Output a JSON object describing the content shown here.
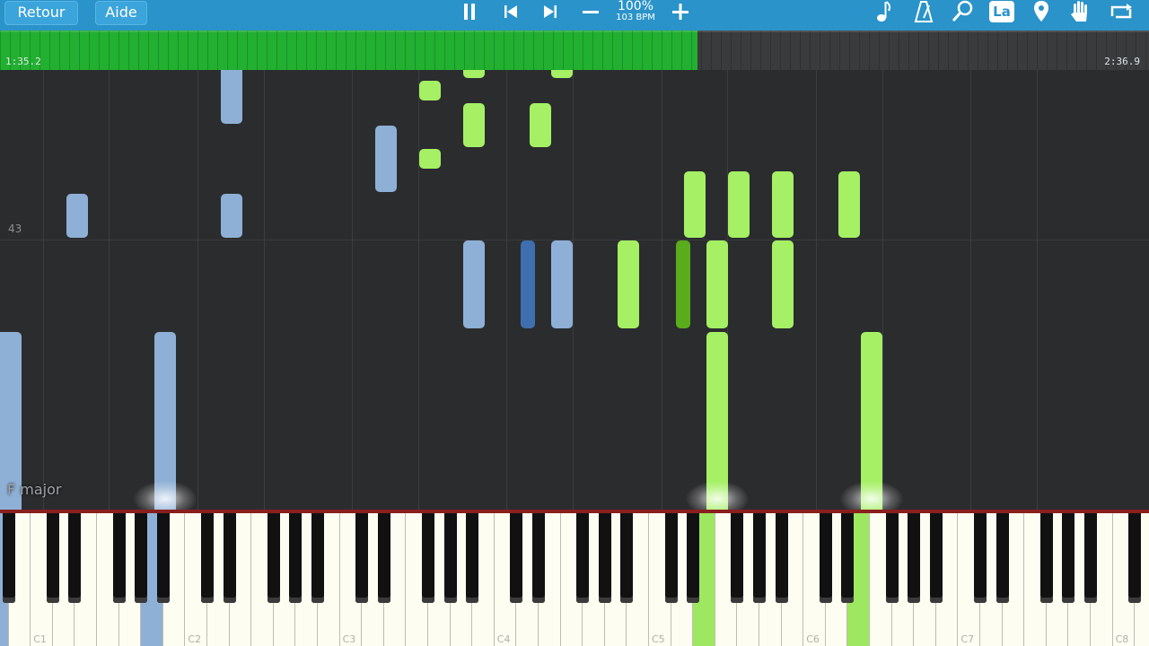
{
  "toolbar": {
    "back_label": "Retour",
    "help_label": "Aide",
    "speed_percent": "100%",
    "bpm": "103 BPM",
    "language_label": "La",
    "icons": [
      "pause-icon",
      "skip-back-icon",
      "skip-forward-icon",
      "minus-icon",
      "plus-icon",
      "music-note-icon",
      "metronome-icon",
      "magnifier-icon",
      "language-icon",
      "location-pin-icon",
      "hand-icon",
      "loop-icon"
    ]
  },
  "progress": {
    "elapsed": "1:35.2",
    "total": "2:36.9",
    "fraction": 0.607
  },
  "roll": {
    "measure_label": "43",
    "key_signature": "F major"
  },
  "keyboard": {
    "octave_labels": [
      "C1",
      "C2",
      "C3",
      "C4",
      "C5",
      "C6",
      "C7",
      "C8"
    ]
  },
  "colors": {
    "toolbar": "#2a93c9",
    "progress": "#22b030",
    "left_hand_note": "#8fb0d6",
    "right_hand_note": "#a5f065"
  }
}
